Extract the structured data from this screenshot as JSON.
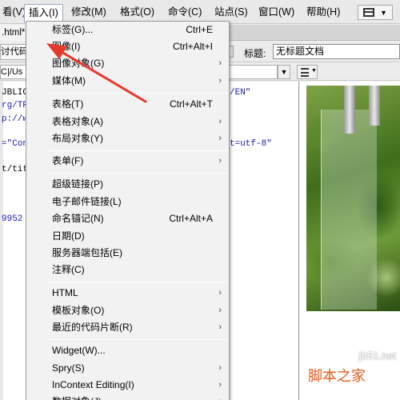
{
  "menubar": {
    "items": [
      {
        "label": "看(V)"
      },
      {
        "label": "插入(I)"
      },
      {
        "label": "修改(M)"
      },
      {
        "label": "格式(O)"
      },
      {
        "label": "命令(C)"
      },
      {
        "label": "站点(S)"
      },
      {
        "label": "窗口(W)"
      },
      {
        "label": "帮助(H)"
      }
    ],
    "layout_icon": "grid-layout-icon"
  },
  "tab": {
    "label": ".html*"
  },
  "toolbar": {
    "code_button": "讨代码",
    "title_label": "标题:",
    "title_value": "无标题文档"
  },
  "addressbar": {
    "value": "C|/Us"
  },
  "code": {
    "lines": [
      {
        "text": "JBLIC"
      },
      {
        "text": "rg/TR"
      },
      {
        "text": "p://w"
      },
      {
        "text": "=\"Con"
      },
      {
        "text": "t/tit"
      },
      {
        "text": "9952"
      },
      {
        "text": "/EN\""
      },
      {
        "text": "t=utf-8\""
      }
    ]
  },
  "menu": {
    "items": [
      {
        "label": "标签(G)...",
        "shortcut": "Ctrl+E"
      },
      {
        "label": "图像(I)",
        "shortcut": "Ctrl+Alt+I"
      },
      {
        "label": "图像对象(G)",
        "submenu": "›"
      },
      {
        "label": "媒体(M)",
        "submenu": "›"
      },
      {
        "label": "表格(T)",
        "shortcut": "Ctrl+Alt+T"
      },
      {
        "label": "表格对象(A)",
        "submenu": "›"
      },
      {
        "label": "布局对象(Y)",
        "submenu": "›"
      },
      {
        "label": "表单(F)",
        "submenu": "›"
      },
      {
        "label": "超级链接(P)"
      },
      {
        "label": "电子邮件链接(L)"
      },
      {
        "label": "命名锚记(N)",
        "shortcut": "Ctrl+Alt+A"
      },
      {
        "label": "日期(D)"
      },
      {
        "label": "服务器端包括(E)"
      },
      {
        "label": "注释(C)"
      },
      {
        "label": "HTML",
        "submenu": "›"
      },
      {
        "label": "模板对象(O)",
        "submenu": "›"
      },
      {
        "label": "最近的代码片断(R)",
        "submenu": "›"
      },
      {
        "label": "Widget(W)..."
      },
      {
        "label": "Spry(S)",
        "submenu": "›"
      },
      {
        "label": "InContext Editing(I)",
        "submenu": "›"
      },
      {
        "label": "数据对象(J)",
        "submenu": "›"
      }
    ]
  },
  "watermark": {
    "url": "jb51.net",
    "name": "脚本之家"
  },
  "colors": {
    "annotation_arrow": "#e8382c",
    "highlight": "#dfe9f5"
  }
}
